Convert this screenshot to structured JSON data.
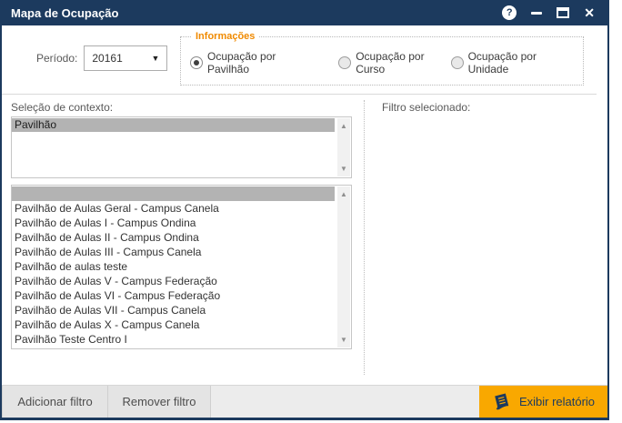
{
  "window": {
    "title": "Mapa de Ocupação",
    "controls": {
      "help": "?",
      "close": "✕"
    }
  },
  "header": {
    "period_label": "Período:",
    "period_value": "20161",
    "informacoes": {
      "legend": "Informações",
      "options": [
        {
          "label": "Ocupação por Pavilhão",
          "selected": true
        },
        {
          "label": "Ocupação por Curso",
          "selected": false
        },
        {
          "label": "Ocupação por Unidade",
          "selected": false
        }
      ]
    }
  },
  "context": {
    "label": "Seleção de contexto:",
    "context_list": [
      {
        "label": "Pavilhão",
        "selected": true
      }
    ],
    "items_list": [
      {
        "label": "",
        "selected": true
      },
      {
        "label": "Pavilhão de Aulas Geral - Campus Canela",
        "selected": false
      },
      {
        "label": "Pavilhão de Aulas I - Campus Ondina",
        "selected": false
      },
      {
        "label": "Pavilhão de Aulas II - Campus Ondina",
        "selected": false
      },
      {
        "label": "Pavilhão de Aulas III - Campus Canela",
        "selected": false
      },
      {
        "label": "Pavilhão de aulas teste",
        "selected": false
      },
      {
        "label": "Pavilhão de Aulas V - Campus Federação",
        "selected": false
      },
      {
        "label": "Pavilhão de Aulas VI - Campus Federação",
        "selected": false
      },
      {
        "label": "Pavilhão de Aulas VII - Campus Canela",
        "selected": false
      },
      {
        "label": "Pavilhão de Aulas X - Campus Canela",
        "selected": false
      },
      {
        "label": "Pavilhão Teste Centro I",
        "selected": false
      }
    ],
    "scroll_up_glyph": "▲",
    "scroll_down_glyph": "▼"
  },
  "filter": {
    "label": "Filtro selecionado:"
  },
  "footer": {
    "add_button": "Adicionar filtro",
    "remove_button": "Remover filtro",
    "report_button": "Exibir relatório"
  },
  "colors": {
    "titlebar_navy": "#1c3a5e",
    "report_orange": "#f9a800",
    "legend_orange": "#f08a00",
    "selection_gray": "#b3b3b3"
  }
}
